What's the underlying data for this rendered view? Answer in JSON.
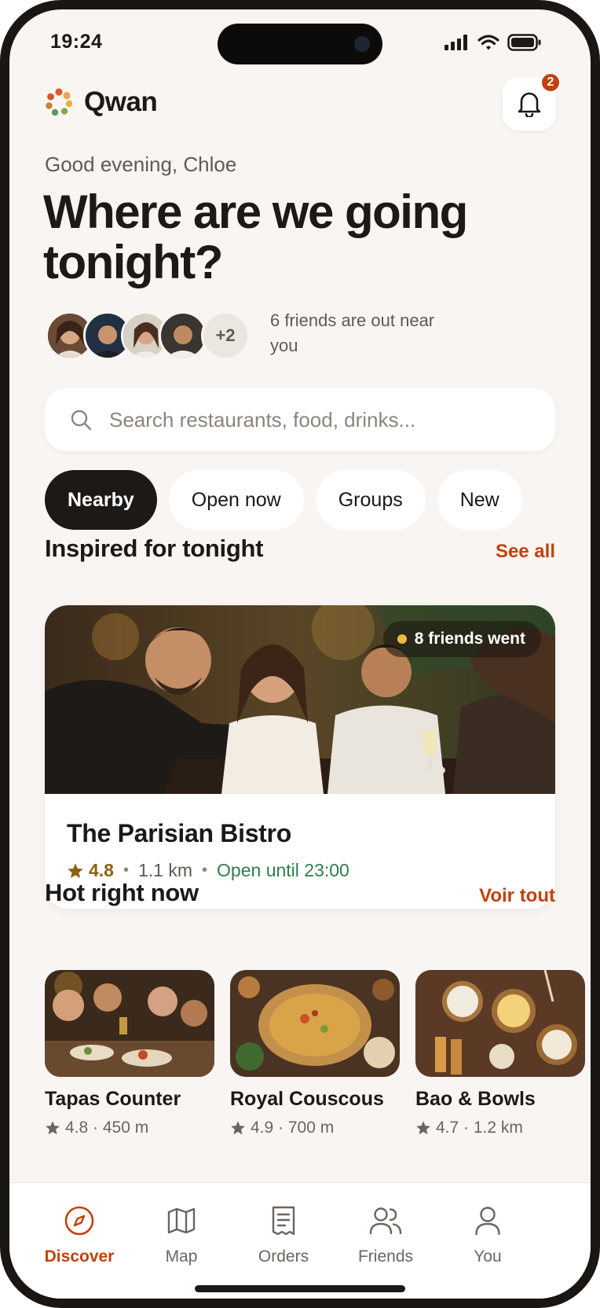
{
  "status_bar": {
    "time": "19:24"
  },
  "header": {
    "app_name": "Qwan",
    "notification_count": "2"
  },
  "hero": {
    "greeting": "Good evening, Chloe",
    "headline": "Where are we going tonight?"
  },
  "friends": {
    "extra_count": "+2",
    "text": "6 friends are out near you"
  },
  "search": {
    "placeholder": "Search restaurants, food, drinks..."
  },
  "chips": [
    {
      "label": "Nearby",
      "active": true
    },
    {
      "label": "Open now",
      "active": false
    },
    {
      "label": "Groups",
      "active": false
    },
    {
      "label": "New",
      "active": false
    }
  ],
  "inspired": {
    "title": "Inspired for tonight",
    "link": "See all",
    "card": {
      "badge": "8 friends went",
      "name": "The Parisian Bistro",
      "rating": "4.8",
      "distance": "1.1 km",
      "hours": "Open until 23:00"
    }
  },
  "hot": {
    "title": "Hot right now",
    "link": "Voir tout",
    "items": [
      {
        "name": "Tapas Counter",
        "meta": "4.8 · 450 m"
      },
      {
        "name": "Royal Couscous",
        "meta": "4.9 · 700 m"
      },
      {
        "name": "Bao & Bowls",
        "meta": "4.7 · 1.2 km"
      }
    ]
  },
  "tabbar": {
    "tabs": [
      {
        "label": "Discover",
        "icon": "compass-icon",
        "active": true
      },
      {
        "label": "Map",
        "icon": "map-icon",
        "active": false
      },
      {
        "label": "Orders",
        "icon": "receipt-icon",
        "active": false
      },
      {
        "label": "Friends",
        "icon": "users-icon",
        "active": false
      },
      {
        "label": "You",
        "icon": "user-icon",
        "active": false
      }
    ]
  },
  "colors": {
    "accent": "#c2410c",
    "background": "#f8f5f2",
    "dark": "#1c1917",
    "open_green": "#2f7d4d",
    "star": "#8a6412"
  }
}
